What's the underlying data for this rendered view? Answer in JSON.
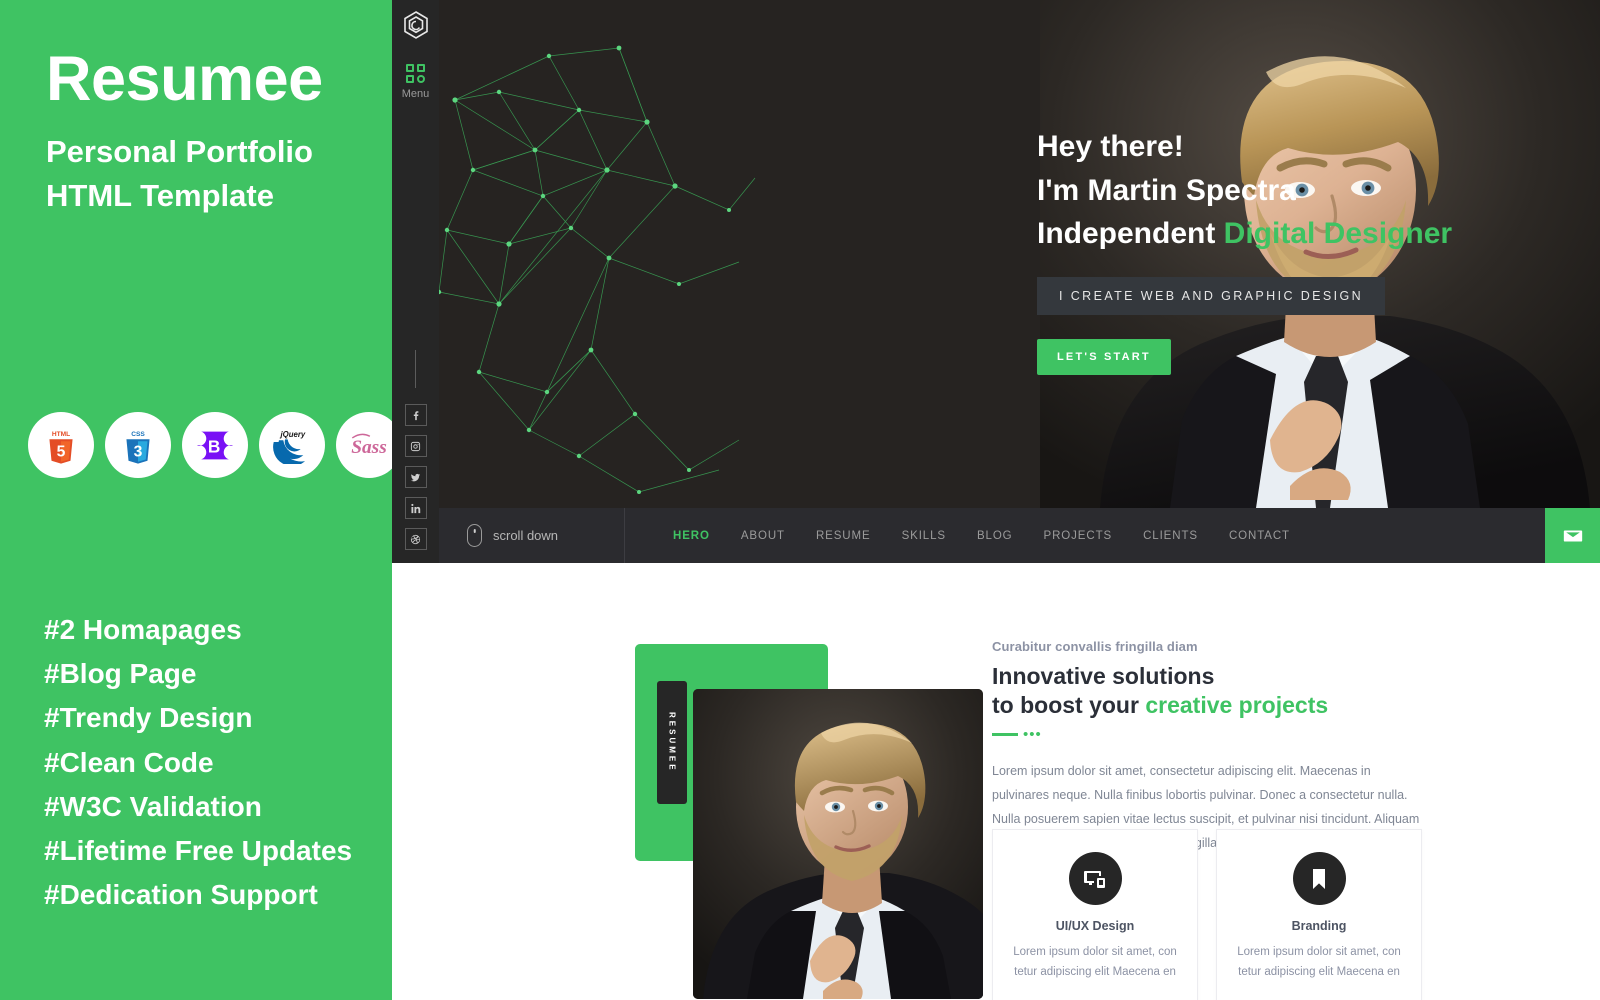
{
  "promo": {
    "title": "Resumee",
    "subtitle_line1": "Personal Portfolio",
    "subtitle_line2": "HTML Template",
    "bg_color": "#3fc363",
    "badges": [
      {
        "name": "html5-badge",
        "label": "HTML5"
      },
      {
        "name": "css3-badge",
        "label": "CSS3"
      },
      {
        "name": "bootstrap-badge",
        "label": "Bootstrap"
      },
      {
        "name": "jquery-badge",
        "label": "jQuery"
      },
      {
        "name": "sass-badge",
        "label": "Sass"
      }
    ],
    "features": [
      "#2 Homapages",
      "#Blog Page",
      "#Trendy Design",
      "#Clean Code",
      "#W3C Validation",
      "#Lifetime Free Updates",
      "#Dedication Support"
    ]
  },
  "rail": {
    "logo_icon": "hexagon-logo-icon",
    "menu_label": "Menu",
    "socials": [
      {
        "name": "facebook-icon",
        "label": "f"
      },
      {
        "name": "instagram-icon",
        "label": "Instagram"
      },
      {
        "name": "twitter-icon",
        "label": "Twitter"
      },
      {
        "name": "linkedin-icon",
        "label": "LinkedIn"
      },
      {
        "name": "dribbble-icon",
        "label": "Dribbble"
      }
    ]
  },
  "hero": {
    "greeting": "Hey there!",
    "name_line": "I'm Martin Spectra",
    "role_prefix": "Independent ",
    "role_accent": "Digital Designer",
    "tagline": "I CREATE WEB AND GRAPHIC DESIGN",
    "cta_label": "LET'S START",
    "accent_color": "#3fc363",
    "bg_color": "#262321"
  },
  "navbar": {
    "scroll_label": "scroll down",
    "links": [
      {
        "label": "HERO",
        "active": true
      },
      {
        "label": "ABOUT",
        "active": false
      },
      {
        "label": "RESUME",
        "active": false
      },
      {
        "label": "SKILLS",
        "active": false
      },
      {
        "label": "BLOG",
        "active": false
      },
      {
        "label": "PROJECTS",
        "active": false
      },
      {
        "label": "CLIENTS",
        "active": false
      },
      {
        "label": "CONTACT",
        "active": false
      }
    ],
    "mail_icon": "envelope-icon"
  },
  "about": {
    "badge_text": "RESUMEE",
    "eyebrow": "Curabitur convallis fringilla diam",
    "heading_line1": "Innovative solutions",
    "heading_line2_prefix": "to boost your ",
    "heading_line2_accent": "creative projects",
    "paragraph": "Lorem ipsum dolor sit amet, consectetur adipiscing elit. Maecenas in pulvinares neque. Nulla finibus lobortis pulvinar. Donec a consectetur nulla. Nulla posuerem sapien vitae lectus suscipit, et pulvinar nisi tincidunt. Aliquam erat volutpat. Cura bitur convallis fringilla diam sed aliquam.",
    "cards": [
      {
        "icon": "devices-icon",
        "title": "UI/UX Design",
        "text": "Lorem ipsum dolor sit amet, con tetur adipiscing elit Maecena en"
      },
      {
        "icon": "bookmark-icon",
        "title": "Branding",
        "text": "Lorem ipsum dolor sit amet, con tetur adipiscing elit Maecena en"
      }
    ]
  }
}
